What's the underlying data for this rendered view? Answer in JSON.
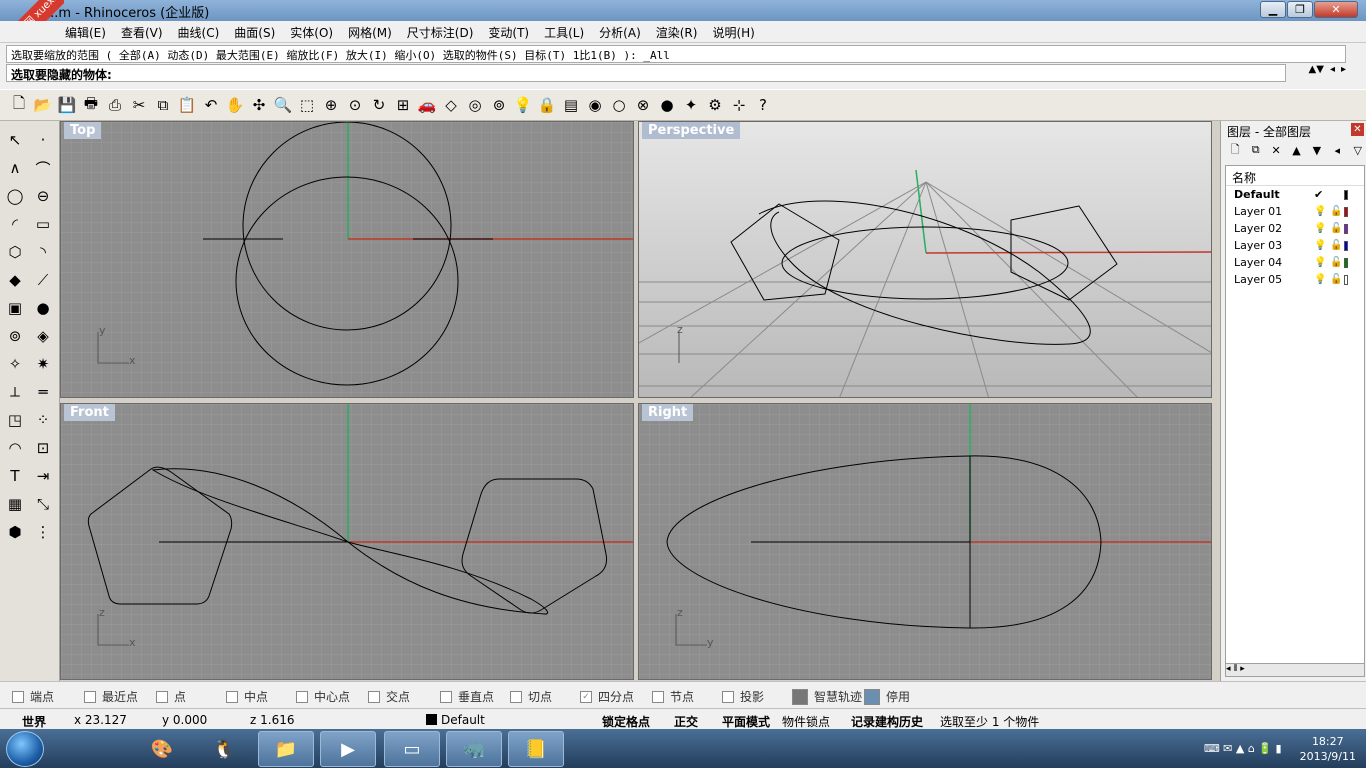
{
  "window": {
    "title": "...m - Rhinoceros (企业版)",
    "btn_min": "▁",
    "btn_max": "❐",
    "btn_close": "✕"
  },
  "watermark": {
    "text": "学犀牛中文网 xuexiniu"
  },
  "menu": [
    "编辑(E)",
    "查看(V)",
    "曲线(C)",
    "曲面(S)",
    "实体(O)",
    "网格(M)",
    "尺寸标注(D)",
    "变动(T)",
    "工具(L)",
    "分析(A)",
    "渲染(R)",
    "说明(H)"
  ],
  "command": {
    "history": "选取要缩放的范围 ( 全部(A) 动态(D) 最大范围(E) 缩放比(F) 放大(I) 缩小(O) 选取的物件(S) 目标(T) 1比1(B) ): _All",
    "prompt": "选取要隐藏的物体:",
    "controls": [
      "▲▼",
      "◂",
      "▸"
    ]
  },
  "toolbar_icons": [
    "new-icon",
    "open-icon",
    "save-icon",
    "print-icon",
    "import-icon",
    "cut-icon",
    "copy-icon",
    "paste-icon",
    "undo-icon",
    "pan-icon",
    "rotate-view-icon",
    "zoom-icon",
    "zoom-window-icon",
    "zoom-extents-icon",
    "zoom-selected-icon",
    "rotate-icon",
    "four-viewports-icon",
    "car-icon",
    "plane-icon",
    "camera-icon",
    "snap-point-icon",
    "bulb-icon",
    "lock-icon",
    "layer-icon",
    "color-wheel-icon",
    "sphere-icon",
    "wire-sphere-icon",
    "render-sphere-icon",
    "light-icon",
    "gear-icon",
    "properties-icon",
    "help-icon"
  ],
  "toolbar_glyphs": [
    "🗋",
    "📂",
    "💾",
    "🖶",
    "⎙",
    "✂",
    "⧉",
    "📋",
    "↶",
    "✋",
    "✣",
    "🔍",
    "⬚",
    "⊕",
    "⊙",
    "↻",
    "⊞",
    "🚗",
    "◇",
    "◎",
    "⊚",
    "💡",
    "🔒",
    "▤",
    "◉",
    "○",
    "⊗",
    "●",
    "✦",
    "⚙",
    "⊹",
    "?"
  ],
  "left_tools": [
    "select-icon",
    "point-icon",
    "polyline-icon",
    "curve-icon",
    "circle-icon",
    "ellipse-icon",
    "arc-icon",
    "rectangle-icon",
    "polygon-icon",
    "fillet-icon",
    "surface-icon",
    "extrude-surface-icon",
    "box-icon",
    "sphere-icon",
    "cylinder-icon",
    "loft-icon",
    "boolean-icon",
    "explode-icon",
    "trim-icon",
    "split-icon",
    "group-icon",
    "array-icon",
    "offset-icon",
    "project-icon",
    "text-icon",
    "dimension-icon",
    "block-icon",
    "transform-icon",
    "mesh-icon",
    "grid-icon"
  ],
  "left_glyphs": [
    "↖",
    "·",
    "∧",
    "⌒",
    "◯",
    "⊖",
    "◜",
    "▭",
    "⬡",
    "◝",
    "◆",
    "⟋",
    "▣",
    "●",
    "⊚",
    "◈",
    "✧",
    "✷",
    "⟂",
    "═",
    "◳",
    "⁘",
    "◠",
    "⊡",
    "T",
    "⇥",
    "▦",
    "⤡",
    "⬢",
    "⋮"
  ],
  "viewports": {
    "top": "Top",
    "perspective": "Perspective",
    "front": "Front",
    "right": "Right"
  },
  "axes": {
    "x": "x",
    "y": "y",
    "z": "z"
  },
  "layers": {
    "title": "图层 - 全部图层",
    "close": "✕",
    "tools": [
      "🗋",
      "⧉",
      "✕",
      "▲",
      "▼",
      "◂",
      "▽"
    ],
    "header": "名称",
    "rows": [
      {
        "name": "Default",
        "current": "✔",
        "color": "#000000"
      },
      {
        "name": "Layer 01",
        "color": "#cc0000"
      },
      {
        "name": "Layer 02",
        "color": "#8020c0"
      },
      {
        "name": "Layer 03",
        "color": "#0000cc"
      },
      {
        "name": "Layer 04",
        "color": "#008000"
      },
      {
        "name": "Layer 05",
        "color": "#ffffff"
      }
    ],
    "bulb": "💡",
    "lock": "🔓",
    "scroll": "◂ ⦀ ▸"
  },
  "osnaps": [
    {
      "label": "端点",
      "checked": false
    },
    {
      "label": "最近点",
      "checked": false
    },
    {
      "label": "点",
      "checked": false
    },
    {
      "label": "中点",
      "checked": false
    },
    {
      "label": "中心点",
      "checked": false
    },
    {
      "label": "交点",
      "checked": false
    },
    {
      "label": "垂直点",
      "checked": false
    },
    {
      "label": "切点",
      "checked": false
    },
    {
      "label": "四分点",
      "checked": true
    },
    {
      "label": "节点",
      "checked": false
    },
    {
      "label": "投影",
      "checked": false
    },
    {
      "label": "智慧轨迹",
      "checked": false
    },
    {
      "label": "停用",
      "checked": false
    }
  ],
  "status": {
    "cplane": "世界",
    "x": "x 23.127",
    "y": "y 0.000",
    "z": "z 1.616",
    "layer": "Default",
    "snap": "锁定格点",
    "ortho": "正交",
    "planar": "平面模式",
    "osnap": "物件锁点",
    "history": "记录建构历史",
    "message": "选取至少 1 个物件"
  },
  "taskbar": {
    "apps": [
      "🎨",
      "🐧",
      "📁",
      "▶",
      "▭",
      "🦏",
      "📒"
    ],
    "time": "18:27",
    "date": "2013/9/11",
    "tray": "⌨ ✉ ▲ ⌂ 🔋 ▮"
  },
  "colors": {
    "x_axis": "#c0392b",
    "y_axis": "#27ae60",
    "curve": "#000000",
    "grid": "#9a9a9a"
  }
}
